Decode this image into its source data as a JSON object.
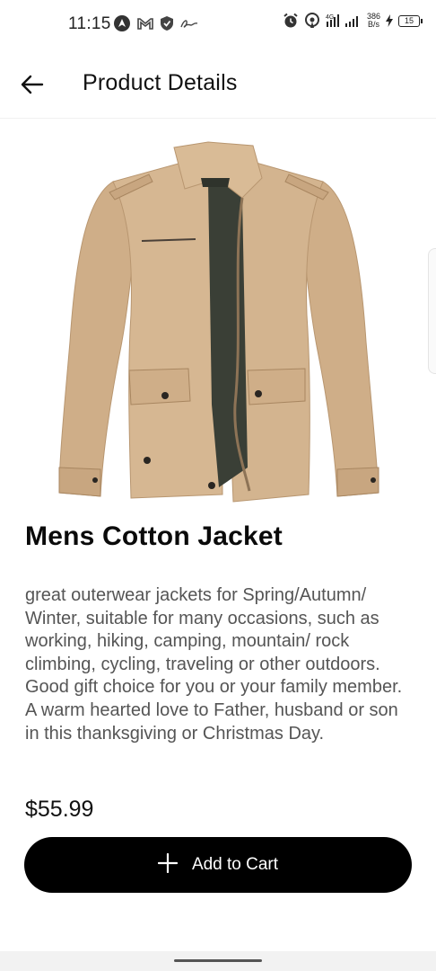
{
  "status_bar": {
    "time": "11:15",
    "net_speed_value": "386",
    "net_speed_unit": "B/s",
    "network_type": "4G",
    "battery": "15"
  },
  "app_bar": {
    "title": "Product Details",
    "back_icon": "arrow-left-icon"
  },
  "product": {
    "name": "Mens Cotton Jacket",
    "description": "great outerwear jackets for Spring/Autumn/ Winter, suitable for many occasions, such as working, hiking, camping, mountain/ rock climbing, cycling, traveling or other outdoors. Good gift choice for you or your family member. A warm hearted love to Father, husband or son in this thanksgiving or Christmas Day.",
    "price": "$55.99",
    "image_icon": "jacket-image"
  },
  "actions": {
    "add_to_cart_label": "Add to Cart",
    "add_icon": "plus-icon"
  },
  "colors": {
    "button_bg": "#000000",
    "jacket": "#d3b48f"
  }
}
